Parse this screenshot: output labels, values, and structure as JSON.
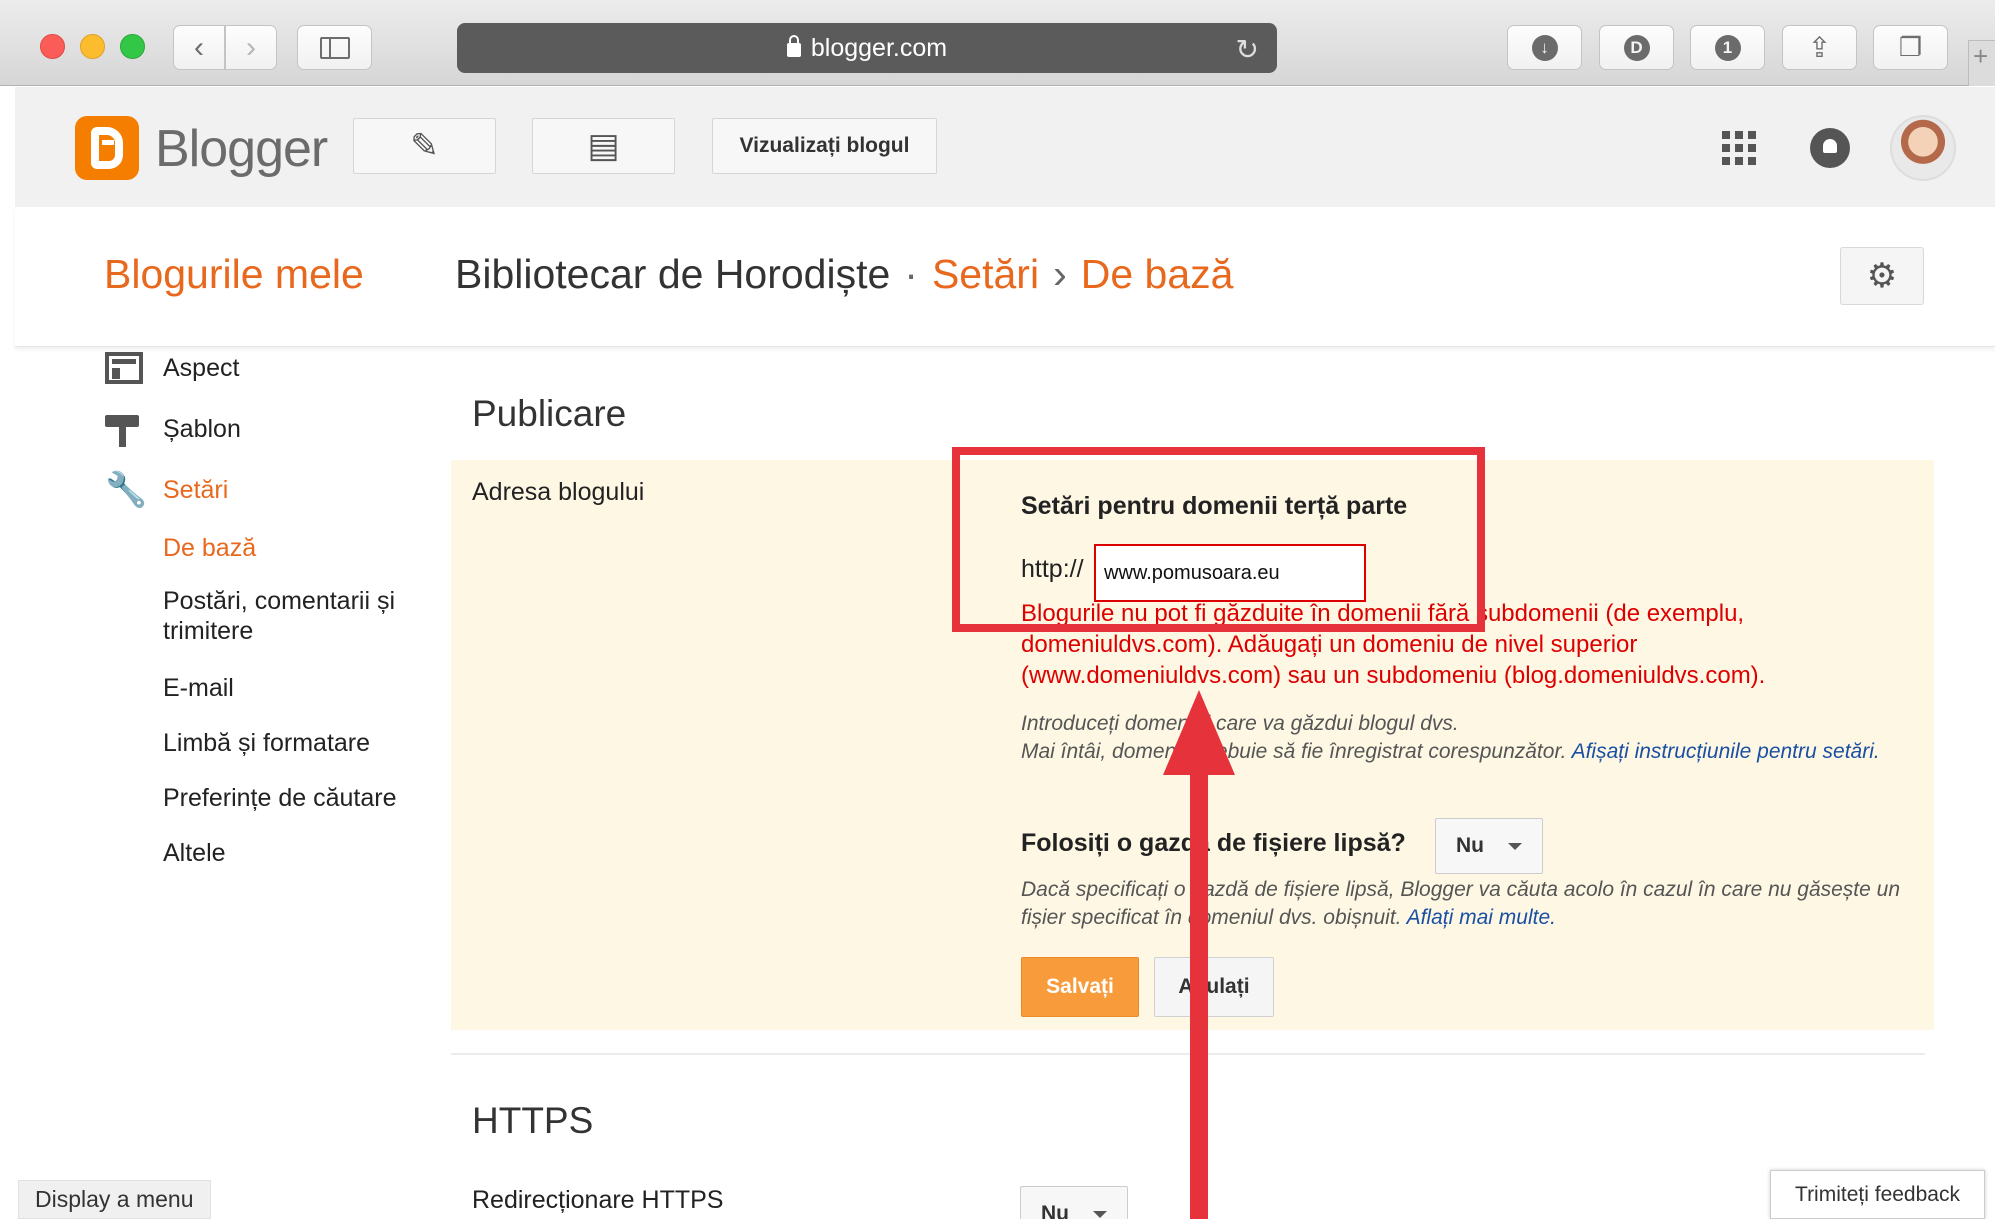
{
  "browser": {
    "url_text": "blogger.com",
    "new_tab_symbol": "+"
  },
  "header": {
    "app_name": "Blogger",
    "view_blog_button": "Vizualizați blogul"
  },
  "title_row": {
    "my_blogs": "Blogurile mele",
    "blog_name": "Bibliotecar de Horodiște",
    "separator": "·",
    "section": "Setări",
    "arrow": "›",
    "page": "De bază"
  },
  "sidebar": {
    "items": [
      {
        "label": "Aspect",
        "icon": "layout-icon"
      },
      {
        "label": "Șablon",
        "icon": "paint-roller-icon"
      },
      {
        "label": "Setări",
        "icon": "wrench-icon"
      }
    ],
    "sub_items": [
      "De bază",
      "Postări, comentarii și trimitere",
      "E-mail",
      "Limbă și formatare",
      "Preferințe de căutare",
      "Altele"
    ]
  },
  "publishing": {
    "section_title": "Publicare",
    "blog_address_label": "Adresa blogului",
    "third_party_heading": "Setări pentru domenii terță parte",
    "http_prefix": "http://",
    "domain_value": "www.pomusoara.eu",
    "error_text": "Blogurile nu pot fi găzduite în domenii fără subdomenii (de exemplu, domeniuldvs.com). Adăugați un domeniu de nivel superior (www.domeniuldvs.com) sau un subdomeniu (blog.domeniuldvs.com).",
    "hint_line1": "Introduceți domeniul care va găzdui blogul dvs.",
    "hint_line2": "Mai întâi, domeniul trebuie să fie înregistrat corespunzător.",
    "hint_link": "Afișați instrucțiunile pentru setări.",
    "missing_files_question": "Folosiți o gazdă de fișiere lipsă?",
    "missing_files_value": "Nu",
    "missing_files_hint": "Dacă specificați o gazdă de fișiere lipsă, Blogger va căuta acolo în cazul în care nu găsește un fișier specificat în domeniul dvs. obișnuit.",
    "missing_files_link": "Aflați mai multe.",
    "save_button": "Salvați",
    "cancel_button": "Anulați"
  },
  "https": {
    "section_title": "HTTPS",
    "redirect_label": "Redirecționare HTTPS",
    "redirect_value": "Nu"
  },
  "footer": {
    "display_menu": "Display a menu",
    "feedback": "Trimiteți feedback"
  },
  "colors": {
    "accent_orange": "#e8681e",
    "error_red": "#dd0000",
    "annotation_red": "#e5323b",
    "panel_bg": "#fdf7e4"
  }
}
